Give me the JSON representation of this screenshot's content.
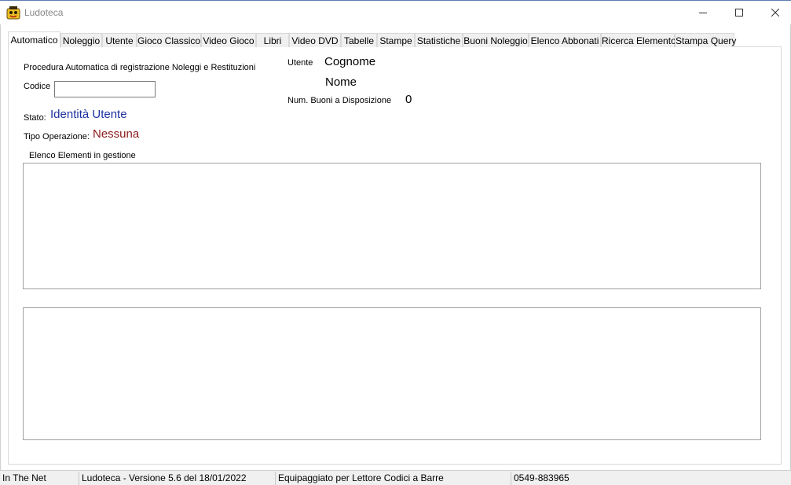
{
  "window": {
    "title": "Ludoteca",
    "icon": "ludoteca-app-icon",
    "controls": [
      "minimize-icon",
      "maximize-icon",
      "close-icon"
    ]
  },
  "tabs": [
    {
      "label": "Automatico",
      "active": true
    },
    {
      "label": "Noleggio"
    },
    {
      "label": "Utente"
    },
    {
      "label": "Gioco Classico"
    },
    {
      "label": "Video Gioco"
    },
    {
      "label": "Libri"
    },
    {
      "label": "Video DVD"
    },
    {
      "label": "Tabelle"
    },
    {
      "label": "Stampe"
    },
    {
      "label": "Statistiche"
    },
    {
      "label": "Buoni Noleggio"
    },
    {
      "label": "Elenco Abbonati"
    },
    {
      "label": "Ricerca Elemento"
    },
    {
      "label": "Stampa Query"
    }
  ],
  "automatico": {
    "procedure_label": "Procedura Automatica di registrazione Noleggi e Restituzioni",
    "code_label": "Codice",
    "code_value": "",
    "status_label": "Stato:",
    "status_value": "Identità Utente",
    "operation_label": "Tipo Operazione:",
    "operation_value": "Nessuna",
    "user_label": "Utente",
    "surname_value": "Cognome",
    "name_value": "Nome",
    "vouchers_label": "Num. Buoni a Disposizione",
    "vouchers_value": "0",
    "elements_label": "Elenco Elementi in gestione"
  },
  "statusbar": {
    "panels": [
      "In The Net",
      "Ludoteca - Versione 5.6  del 18/01/2022",
      "Equipaggiato per Lettore Codici a Barre",
      "0549-883965"
    ]
  },
  "colors": {
    "status_value": "#1c2fa0",
    "operation_value": "#8b1a1a"
  }
}
